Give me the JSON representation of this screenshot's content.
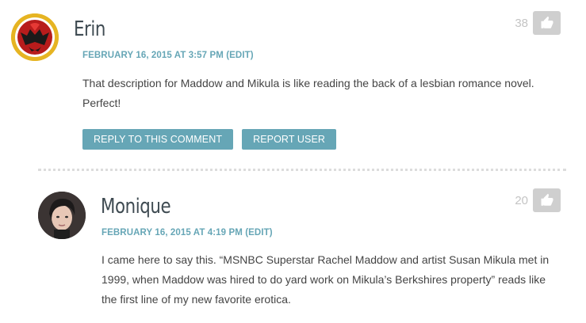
{
  "comments": [
    {
      "author": "Erin",
      "date": "FEBRUARY 16, 2015 AT 3:57 PM",
      "edit_label": "(EDIT)",
      "body": "That description for Maddow and Mikula is like reading the back of a lesbian romance novel. Perfect!",
      "votes": "38",
      "reply_label": "REPLY TO THIS COMMENT",
      "report_label": "REPORT USER",
      "avatar_icon": "batwoman-avatar-icon"
    },
    {
      "author": "Monique",
      "date": "FEBRUARY 16, 2015 AT 4:19 PM",
      "edit_label": "(EDIT)",
      "body": "I came here to say this. “MSNBC Superstar Rachel Maddow and artist Susan Mikula met in 1999, when Maddow was hired to do yard work on Mikula’s Berkshires property” reads like the first line of my new favorite erotica.",
      "votes": "20",
      "avatar_icon": "user-photo-avatar"
    }
  ],
  "colors": {
    "accent": "#66a6b6",
    "vote_button": "#cfcfcf",
    "author_text": "#3f4b52"
  }
}
